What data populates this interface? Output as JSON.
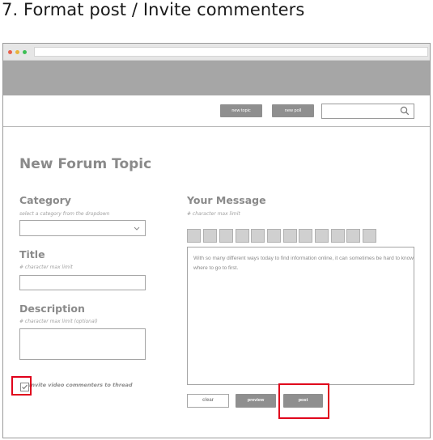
{
  "heading": "7. Format post / Invite commenters",
  "header": {
    "new_topic_label": "new topic",
    "new_poll_label": "new poll",
    "search_placeholder": ""
  },
  "form": {
    "page_title": "New Forum Topic",
    "category_label": "Category",
    "category_hint": "select a category from the dropdown",
    "category_value": "",
    "title_label": "Title",
    "title_hint": "# character max limit",
    "title_value": "",
    "description_label": "Description",
    "description_hint": "# character max limit (optional)",
    "description_value": "",
    "invite_label": "Invite video commenters to thread",
    "invite_checked": true
  },
  "message": {
    "label": "Your Message",
    "hint": "# character max limit",
    "body": "With so many different ways today to find information online, it can sometimes be hard to know where to go to first.",
    "toolbar_count": 12
  },
  "actions": {
    "clear_label": "clear",
    "preview_label": "preview",
    "post_label": "post"
  },
  "colors": {
    "highlight": "#e0001b",
    "button_gray": "#8f8f8f",
    "banner_gray": "#a6a6a6",
    "dot_red": "#e8604c",
    "dot_yellow": "#e8b33c",
    "dot_green": "#3cbf55"
  },
  "icons": {
    "search": "search-icon",
    "dropdown": "chevron-down-icon",
    "checkbox": "check-icon"
  }
}
